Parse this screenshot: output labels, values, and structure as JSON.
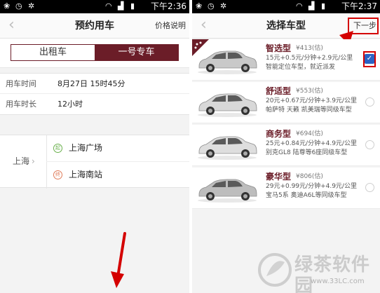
{
  "left": {
    "status": {
      "time": "下午2:36"
    },
    "nav": {
      "back": "‹",
      "title": "预约用车",
      "right": "价格说明"
    },
    "tabs": [
      {
        "label": "出租车",
        "active": false
      },
      {
        "label": "一号专车",
        "active": true
      }
    ],
    "rows": [
      {
        "label": "用车时间",
        "value": "8月27日 15时45分"
      },
      {
        "label": "用车时长",
        "value": "12小时"
      }
    ],
    "location": {
      "city": "上海",
      "city_chevron": "›",
      "start_badge": "起",
      "start": "上海广场",
      "end_badge": "终",
      "end": "上海南站"
    }
  },
  "right": {
    "status": {
      "time": "下午2:37"
    },
    "nav": {
      "back": "‹",
      "title": "选择车型",
      "right": "下一步"
    },
    "cars": [
      {
        "name": "智选型",
        "price": "¥413(估)",
        "rate": "15元+0.5元/分钟+2.9元/公里",
        "desc": "智能定位车型，就近派发",
        "selected": true,
        "color": "#c9c9c9"
      },
      {
        "name": "舒适型",
        "price": "¥553(估)",
        "rate": "20元+0.67元/分钟+3.9元/公里",
        "desc": "帕萨特 天籁 凯美瑞等同级车型",
        "selected": false,
        "color": "#d8d8d8"
      },
      {
        "name": "商务型",
        "price": "¥694(估)",
        "rate": "25元+0.84元/分钟+4.9元/公里",
        "desc": "别克GL8 陆尊等6座同级车型",
        "selected": false,
        "color": "#dedede"
      },
      {
        "name": "豪华型",
        "price": "¥806(估)",
        "rate": "29元+0.99元/分钟+4.9元/公里",
        "desc": "宝马5系 奥迪A6L等同级车型",
        "selected": false,
        "color": "#bdbdbd"
      }
    ],
    "checkmark": "✓"
  },
  "watermark": {
    "text": "绿茶软件园",
    "url": "www.33LC.com"
  },
  "colors": {
    "brand": "#6b1d28",
    "annotation": "#d40000",
    "check": "#2a62c4"
  }
}
